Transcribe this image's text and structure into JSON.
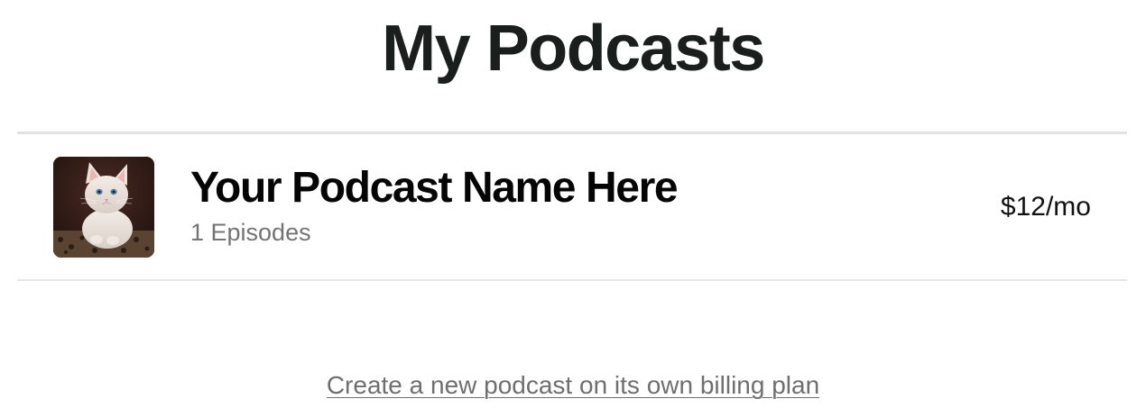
{
  "page": {
    "title": "My Podcasts"
  },
  "podcasts": [
    {
      "name": "Your Podcast Name Here",
      "episodes": "1 Episodes",
      "price": "$12/mo",
      "artwork_icon": "kitten-artwork"
    }
  ],
  "actions": {
    "create_link": "Create a new podcast on its own billing plan"
  },
  "colors": {
    "title": "#1a1e1d",
    "name": "#050505",
    "muted": "#747474",
    "divider": "#e2e2e2"
  }
}
